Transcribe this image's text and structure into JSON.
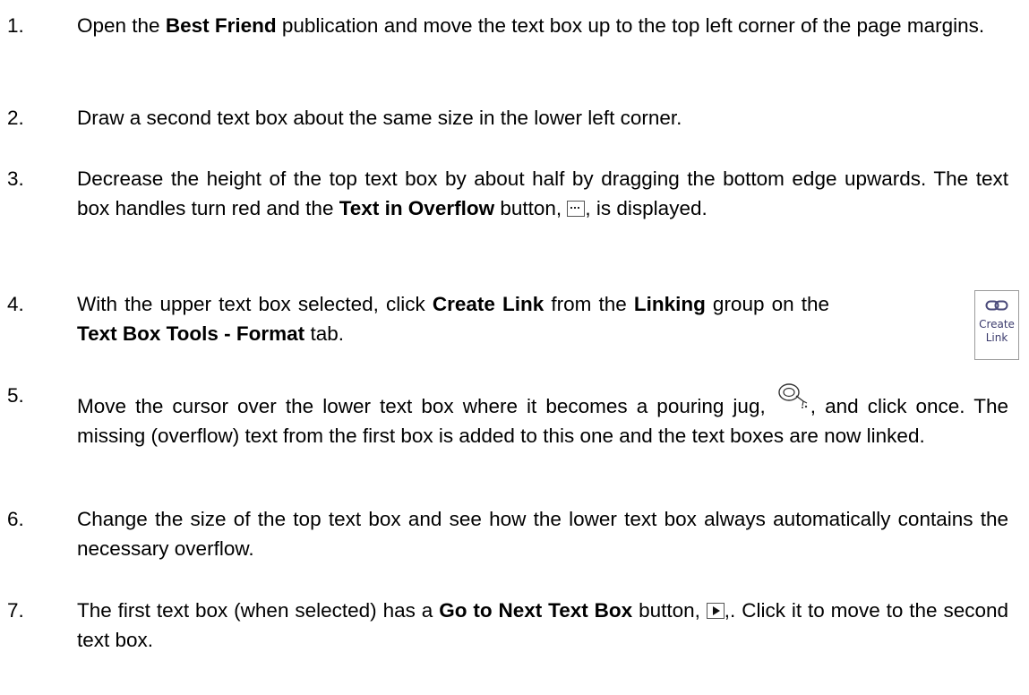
{
  "steps": [
    {
      "number": "1.",
      "parts": [
        {
          "t": "Open the "
        },
        {
          "b": "Best Friend"
        },
        {
          "t": " publication and move the text box up to the top left corner of the page margins."
        }
      ]
    },
    {
      "number": "2.",
      "parts": [
        {
          "t": "Draw a second text box about the same size in the lower left corner."
        }
      ]
    },
    {
      "number": "3.",
      "parts": [
        {
          "t": "Decrease the height of the top text box by about half by dragging the bottom edge upwards. The text box handles turn red and the "
        },
        {
          "b": "Text in Overflow"
        },
        {
          "t": " button, "
        },
        {
          "icon": "text-overflow-icon"
        },
        {
          "t": ", is displayed."
        }
      ]
    },
    {
      "number": "4.",
      "parts": [
        {
          "t": "With the upper text box selected, click "
        },
        {
          "b": "Create Link"
        },
        {
          "t": " from the "
        },
        {
          "b": "Linking"
        },
        {
          "t": " group on the "
        },
        {
          "b": "Text Box Tools - Format"
        },
        {
          "t": " tab."
        }
      ]
    },
    {
      "number": "5.",
      "parts": [
        {
          "t": "Move the cursor over the lower text box where it becomes a pouring jug, "
        },
        {
          "icon": "pouring-jug-icon"
        },
        {
          "t": ", and click once. The missing (overflow) text from the first box is added to this one and the text boxes are now linked."
        }
      ]
    },
    {
      "number": "6.",
      "parts": [
        {
          "t": "Change the size of the top text box and see how the lower text box always automatically contains the necessary overflow."
        }
      ]
    },
    {
      "number": "7.",
      "parts": [
        {
          "t": "The first text box (when selected) has a "
        },
        {
          "b": "Go to Next Text Box"
        },
        {
          "t": " button, "
        },
        {
          "icon": "go-to-next-text-box-icon"
        },
        {
          "t": ",. Click it to move to the second text box."
        }
      ]
    }
  ],
  "create_link_button": {
    "icon": "chain-link-icon",
    "label_line1": "Create",
    "label_line2": "Link"
  }
}
